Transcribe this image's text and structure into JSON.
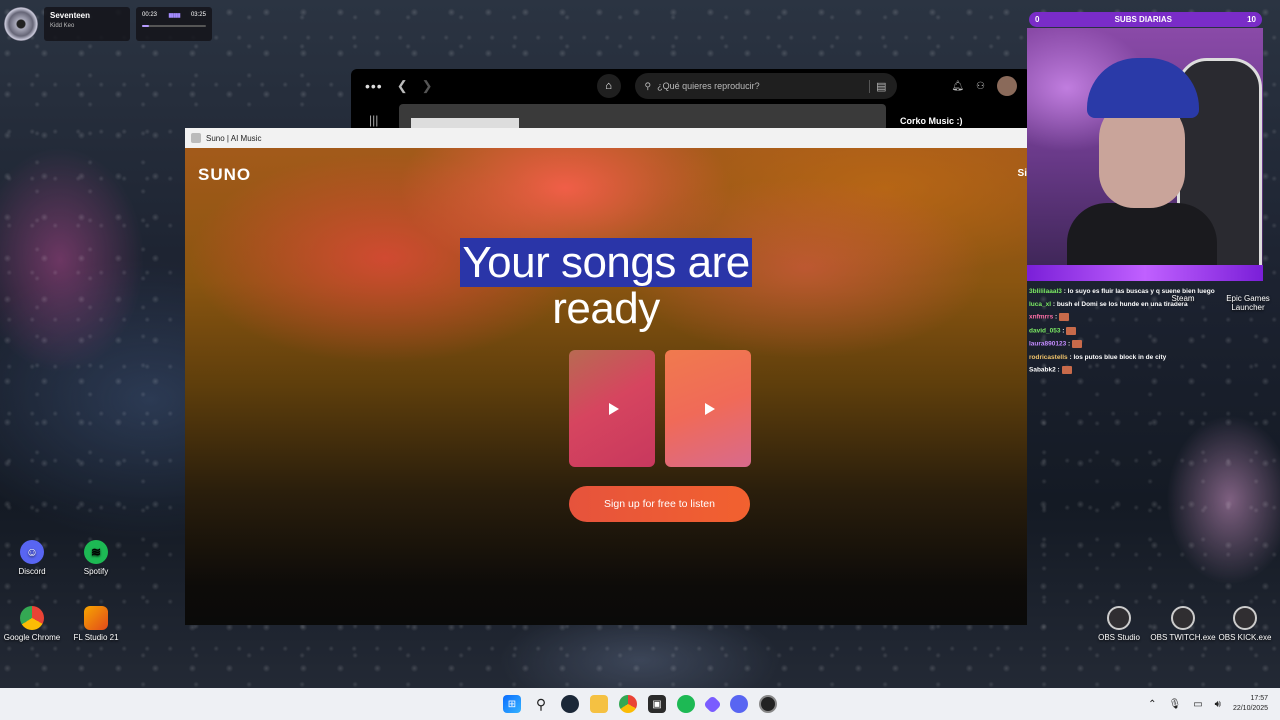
{
  "now_playing": {
    "title": "Seventeen",
    "artist": "Kidd Keo",
    "current_time": "00:23",
    "total_time": "03:25",
    "progress_fraction": 0.11
  },
  "spotify": {
    "search_placeholder": "¿Qué quieres reproducir?",
    "right_panel_title": "Corko Music :)"
  },
  "suno_window": {
    "tab_title": "Suno | AI Music",
    "logo": "SUNO",
    "signin_partial": "Si",
    "headline_highlighted": "Your songs are",
    "headline_rest": "ready",
    "signup_label": "Sign up for free to listen"
  },
  "stream_overlay": {
    "subs_label": "SUBS DIARIAS",
    "subs_current": "0",
    "subs_goal": "10",
    "chat": [
      {
        "user": "3blililaaal3",
        "msg": "lo suyo es fluir las buscas y q suene bien luego",
        "color": "green"
      },
      {
        "user": "luca_xl",
        "msg": "bush el Domi se los hunde en una tiradera",
        "color": "green"
      },
      {
        "user": "xnfmrrs",
        "msg": "",
        "color": "pink"
      },
      {
        "user": "david_053",
        "msg": "",
        "color": "green"
      },
      {
        "user": "laura890123",
        "msg": "",
        "color": "purple"
      },
      {
        "user": "rodricastells",
        "msg": "los putos blue block in de city",
        "color": "gold"
      },
      {
        "user": "Sababk2",
        "msg": "",
        "color": "white"
      }
    ]
  },
  "desktop_icons": [
    {
      "label": "Discord",
      "icon": "discord-icon"
    },
    {
      "label": "Spotify",
      "icon": "spotify-icon"
    },
    {
      "label": "Google Chrome",
      "icon": "chrome-icon"
    },
    {
      "label": "FL Studio 21",
      "icon": "fl-studio-icon"
    },
    {
      "label": "Steam",
      "icon": "steam-icon"
    },
    {
      "label": "Epic Games Launcher",
      "icon": "epic-games-icon"
    },
    {
      "label": "OBS Studio",
      "icon": "obs-icon"
    },
    {
      "label": "OBS TWITCH.exe",
      "icon": "obs-icon"
    },
    {
      "label": "OBS KICK.exe",
      "icon": "obs-icon"
    }
  ],
  "taskbar": {
    "time": "17:57",
    "date": "22/10/2025"
  }
}
